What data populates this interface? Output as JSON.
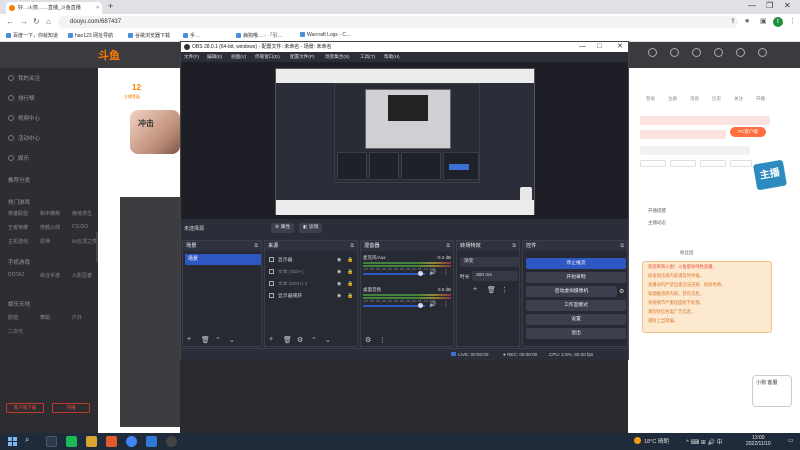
{
  "browser": {
    "tab_title": "好…火箭……直播_斗鱼直播",
    "tab_close": "×",
    "new_tab": "+",
    "window_controls": [
      "—",
      "❐",
      "✕"
    ],
    "url": "douyu.com/687437",
    "bookmarks": [
      "百度一下，你就知道",
      "hao123 网址导航",
      "谷歌浏览器下载",
      "手…",
      "病狗哦… - 「引…",
      "Warcraft Logs - C…"
    ]
  },
  "douyu": {
    "logo": "斗鱼",
    "nav_items": [
      "我的关注",
      "排行榜",
      "视频中心",
      "活动中心",
      "娱乐"
    ],
    "nav_section1": "推荐分类",
    "nav_section2": "热门游戏",
    "nav_section3": "手机游戏",
    "nav_section4": "娱乐天地",
    "nav_small_items": [
      "英雄联盟",
      "和平精英",
      "绝地求生",
      "王者荣耀",
      "穿越火线",
      "CS:GO",
      "主机游戏",
      "原神",
      "lol云顶之弈",
      "DOTA2",
      "综合手游",
      "火影忍者",
      "颜值",
      "舞蹈",
      "户外",
      "二次元"
    ],
    "nav_btn1": "客户端下载",
    "nav_btn2": "开播",
    "room_num": "12",
    "room_sub": "主播等级",
    "char_text": "冲击",
    "pc_button": "PC客户端",
    "right_labels": [
      "登录",
      "注册",
      "消息",
      "历史",
      "关注",
      "开播"
    ],
    "right_texts": [
      "开播提醒",
      "主播动态",
      "粉丝团"
    ],
    "chat_lines": [
      "欢迎来到斗鱼！斗鱼倡导绿色直播，",
      "如发现违规内容请及时举报。",
      "直播间内严禁出现违法违规、低俗色情、",
      "吸烟酗酒等内容，若有违反，",
      "将视情节严重程度给予处理。",
      "请勿轻信各类广告信息，",
      "谨防上当受骗。"
    ],
    "badge": "主播",
    "bot_text": "小狗\n客服"
  },
  "obs": {
    "title": "OBS 28.0.1 (64-bit, windows) - 配置文件: 未命名 - 场景: 未命名",
    "window_controls": [
      "—",
      "□",
      "✕"
    ],
    "menu": [
      "文件(F)",
      "编辑(E)",
      "视图(V)",
      "停靠窗口(D)",
      "配置文件(P)",
      "场景集合(S)",
      "工具(T)",
      "帮助(H)"
    ],
    "scene_label": "未选择源",
    "scene_buttons": [
      "属性",
      "滤镜"
    ],
    "docks": {
      "scenes": "场景",
      "sources": "来源",
      "mixer": "混音器",
      "transitions": "转场特效",
      "controls": "控件"
    },
    "scene_items": [
      "场景"
    ],
    "sources": [
      {
        "name": "显示器",
        "dim": false
      },
      {
        "name": "文本 (GDI+)",
        "dim": true
      },
      {
        "name": "文本 (GDI+) 2",
        "dim": true
      },
      {
        "name": "显示器捕获",
        "dim": false
      }
    ],
    "mixer": [
      {
        "name": "麦克风/Aux",
        "db": "-0.2 dB"
      },
      {
        "name": "桌面音频",
        "db": "0.0 dB"
      }
    ],
    "ticks": "-60 -55 -50 -45 -40 -35 -30 -25 -20 -15 -10 -5 0",
    "transition": {
      "type": "渐变",
      "duration_label": "时长",
      "duration": "300 ms"
    },
    "controls": [
      "停止推流",
      "开始录制",
      "启动虚拟摄像机",
      "工作室模式",
      "设置",
      "退出"
    ],
    "status": {
      "live": "LIVE: 00:00:00",
      "rec": "REC: 00:00:00",
      "cpu": "CPU: 2.5%, 60.00 fps"
    }
  },
  "taskbar": {
    "weather": "18°C 晴朗",
    "time": "13:00",
    "date": "2022/11/10",
    "tray": "^ ⌨ ⊞ 🔊 中"
  },
  "colors": {
    "obs_accent": "#2d58c4",
    "douyu_orange": "#ff7a00"
  }
}
